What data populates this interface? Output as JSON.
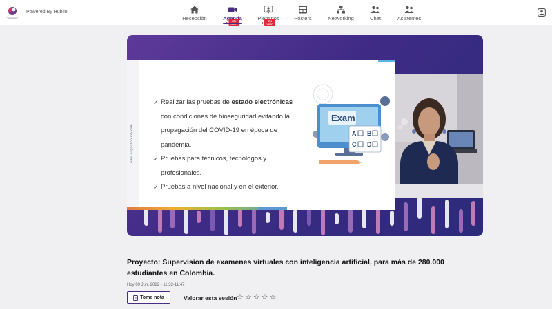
{
  "header": {
    "powered_by": "Powered By Hubilo",
    "nav": [
      {
        "label": "Recepción",
        "icon": "home-icon"
      },
      {
        "label": "Agenda",
        "icon": "video-camera-icon",
        "active": true,
        "live": "EN VIVO"
      },
      {
        "label": "Plenarios",
        "icon": "presentation-icon",
        "live": "EN VIVO"
      },
      {
        "label": "Pósters",
        "icon": "poster-icon"
      },
      {
        "label": "Networking",
        "icon": "network-icon"
      },
      {
        "label": "Chat",
        "icon": "chat-people-icon"
      },
      {
        "label": "Asistentes",
        "icon": "attendees-icon"
      }
    ],
    "right_icon": "profile-icon"
  },
  "slide": {
    "side_url": "www.cognosonline.com",
    "bullets": [
      {
        "pre": "Realizar las pruebas de ",
        "bold": "estado electrónicas",
        "post": " con condiciones de bioseguridad evitando la propagación del COVID-19 en época de pandemia."
      },
      {
        "pre": "Pruebas para técnicos, tecnólogos y profesionales.",
        "bold": "",
        "post": ""
      },
      {
        "pre": "Pruebas a nivel nacional y en el exterior.",
        "bold": "",
        "post": ""
      }
    ],
    "exam_label": "Exam",
    "exam_options": [
      "A",
      "B",
      "C",
      "D"
    ]
  },
  "session": {
    "title": "Proyecto: Supervision de examenes virtuales con inteligencia artificial, para más de 280.000 estudiantes en Colombia.",
    "date": "Hoy 09 Jun, 2022 - 11:32-11:47",
    "note_button": "Tome nota",
    "rate_label": "Valorar esta sesión",
    "stars": 5
  },
  "colors": {
    "accent": "#4b2c83",
    "live": "#e0283a",
    "video_bg": "#3f2b86"
  }
}
